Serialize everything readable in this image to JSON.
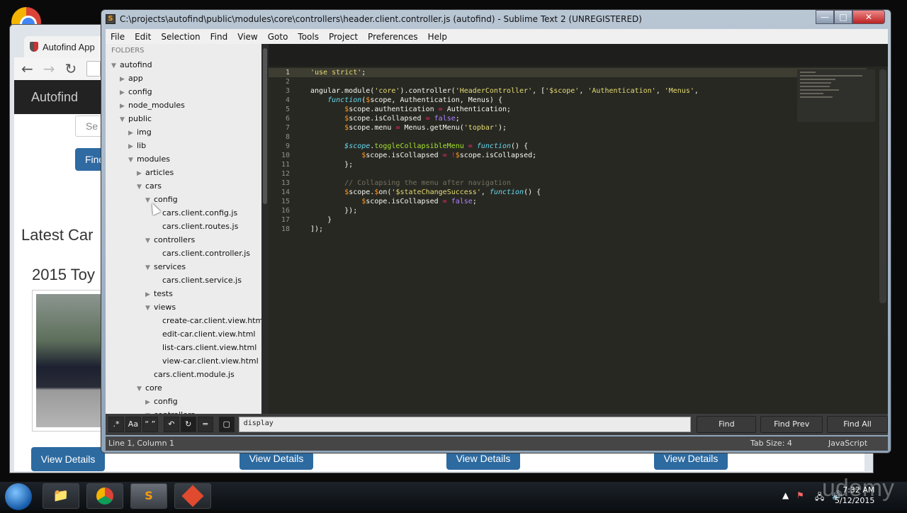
{
  "browser": {
    "tab_title": "Autofind App",
    "site_brand": "Autofind",
    "search_placeholder_partial": "Se",
    "find_button_partial": "Find",
    "latest_heading_partial": "Latest Car",
    "car_title_partial": "2015 Toy",
    "view_details_label": "View Details"
  },
  "sublime": {
    "window_title": "C:\\projects\\autofind\\public\\modules\\core\\controllers\\header.client.controller.js (autofind) - Sublime Text 2 (UNREGISTERED)",
    "menu": [
      "File",
      "Edit",
      "Selection",
      "Find",
      "View",
      "Goto",
      "Tools",
      "Project",
      "Preferences",
      "Help"
    ],
    "sidebar": {
      "header": "FOLDERS",
      "tree": [
        {
          "label": "autofind",
          "depth": 0,
          "state": "open"
        },
        {
          "label": "app",
          "depth": 1,
          "state": "closed"
        },
        {
          "label": "config",
          "depth": 1,
          "state": "closed"
        },
        {
          "label": "node_modules",
          "depth": 1,
          "state": "closed"
        },
        {
          "label": "public",
          "depth": 1,
          "state": "open"
        },
        {
          "label": "img",
          "depth": 2,
          "state": "closed"
        },
        {
          "label": "lib",
          "depth": 2,
          "state": "closed"
        },
        {
          "label": "modules",
          "depth": 2,
          "state": "open"
        },
        {
          "label": "articles",
          "depth": 3,
          "state": "closed"
        },
        {
          "label": "cars",
          "depth": 3,
          "state": "open"
        },
        {
          "label": "config",
          "depth": 4,
          "state": "open"
        },
        {
          "label": "cars.client.config.js",
          "depth": 5,
          "state": "file"
        },
        {
          "label": "cars.client.routes.js",
          "depth": 5,
          "state": "file"
        },
        {
          "label": "controllers",
          "depth": 4,
          "state": "open"
        },
        {
          "label": "cars.client.controller.js",
          "depth": 5,
          "state": "file"
        },
        {
          "label": "services",
          "depth": 4,
          "state": "open"
        },
        {
          "label": "cars.client.service.js",
          "depth": 5,
          "state": "file"
        },
        {
          "label": "tests",
          "depth": 4,
          "state": "closed"
        },
        {
          "label": "views",
          "depth": 4,
          "state": "open"
        },
        {
          "label": "create-car.client.view.html",
          "depth": 5,
          "state": "file"
        },
        {
          "label": "edit-car.client.view.html",
          "depth": 5,
          "state": "file"
        },
        {
          "label": "list-cars.client.view.html",
          "depth": 5,
          "state": "file"
        },
        {
          "label": "view-car.client.view.html",
          "depth": 5,
          "state": "file"
        },
        {
          "label": "cars.client.module.js",
          "depth": 4,
          "state": "file"
        },
        {
          "label": "core",
          "depth": 3,
          "state": "open"
        },
        {
          "label": "config",
          "depth": 4,
          "state": "closed"
        },
        {
          "label": "controllers",
          "depth": 4,
          "state": "open"
        }
      ]
    },
    "code_lines": [
      "<span class=\"s\">'use strict'</span>;",
      "",
      "angular.module(<span class=\"s\">'core'</span>).controller(<span class=\"s\">'HeaderController'</span>, [<span class=\"s\">'$scope'</span>, <span class=\"s\">'Authentication'</span>, <span class=\"s\">'Menus'</span>,",
      "    <span class=\"f\">function</span>(<span class=\"v\">$</span>scope, Authentication, Menus) {",
      "        <span class=\"v\">$</span>scope.authentication <span class=\"k\">=</span> Authentication;",
      "        <span class=\"v\">$</span>scope.isCollapsed <span class=\"k\">=</span> <span class=\"n\">false</span>;",
      "        <span class=\"v\">$</span>scope.menu <span class=\"k\">=</span> Menus.getMenu(<span class=\"s\">'topbar'</span>);",
      "",
      "        <span class=\"f\">$scope</span>.<span class=\"g\">toggleCollapsibleMenu</span> <span class=\"k\">=</span> <span class=\"f\">function</span>() {",
      "            <span class=\"v\">$</span>scope.isCollapsed <span class=\"k\">=</span> <span class=\"k\">!</span><span class=\"v\">$</span>scope.isCollapsed;",
      "        };",
      "",
      "        <span class=\"c\">// Collapsing the menu after navigation</span>",
      "        <span class=\"v\">$</span>scope.<span class=\"v\">$</span>on(<span class=\"s\">'$stateChangeSuccess'</span>, <span class=\"f\">function</span>() {",
      "            <span class=\"v\">$</span>scope.isCollapsed <span class=\"k\">=</span> <span class=\"n\">false</span>;",
      "        });",
      "    }",
      "]);"
    ],
    "find_panel": {
      "toggles": [
        ".*",
        "Aa",
        "“ ”",
        "↶",
        "↻",
        "═",
        "▢"
      ],
      "query": "display",
      "find_label": "Find",
      "find_prev_label": "Find Prev",
      "find_all_label": "Find All"
    },
    "status": {
      "position": "Line 1, Column 1",
      "tab_size": "Tab Size: 4",
      "syntax": "JavaScript"
    }
  },
  "taskbar": {
    "time": "7:32 AM",
    "date": "5/12/2015"
  },
  "watermark": "udemy"
}
